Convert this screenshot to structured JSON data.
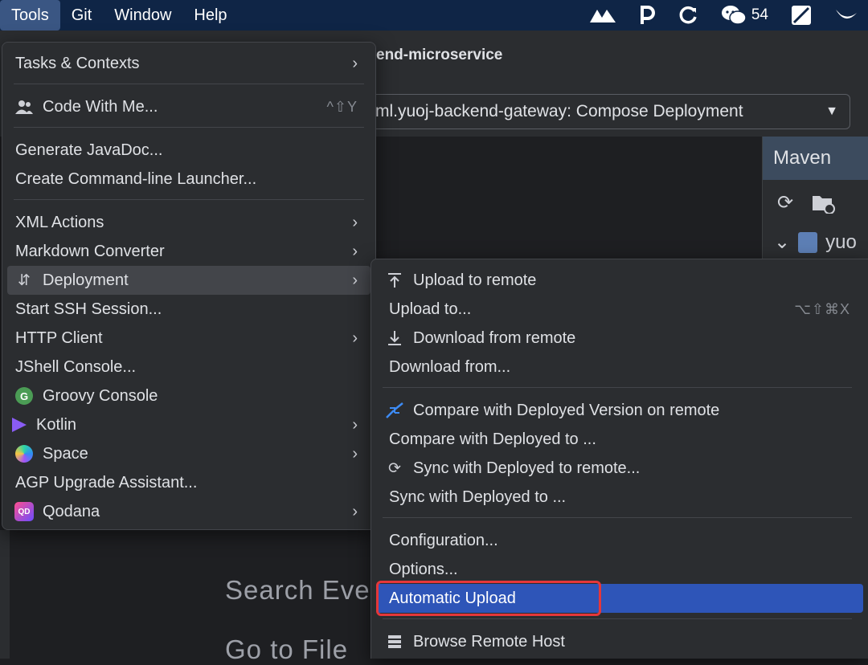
{
  "menubar": {
    "items": [
      {
        "label": "Tools",
        "active": true
      },
      {
        "label": "Git",
        "active": false
      },
      {
        "label": "Window",
        "active": false
      },
      {
        "label": "Help",
        "active": false
      }
    ],
    "tray": {
      "wechat_count": "54",
      "icons": [
        "mountain-icon",
        "p-icon",
        "refresh-circle-icon",
        "wechat-icon",
        "screen-icon",
        "bird-icon"
      ]
    }
  },
  "ide": {
    "project_title": "end-microservice",
    "run_config": "ml.yuoj-backend-gateway: Compose Deployment",
    "maven_title": "Maven",
    "maven_tree_item": "yuo",
    "editor_hint_1": "Search Ever",
    "editor_hint_2": "Go to File"
  },
  "tools_menu": {
    "items": [
      {
        "label": "Tasks & Contexts",
        "submenu": true
      },
      {
        "label": "Code With Me...",
        "shortcut": "^⇧Y",
        "icon": "users-icon"
      },
      {
        "label": "Generate JavaDoc..."
      },
      {
        "label": "Create Command-line Launcher..."
      },
      {
        "label": "XML Actions",
        "submenu": true
      },
      {
        "label": "Markdown Converter",
        "submenu": true
      },
      {
        "label": "Deployment",
        "submenu": true,
        "icon": "deployment-icon",
        "hovered": true
      },
      {
        "label": "Start SSH Session..."
      },
      {
        "label": "HTTP Client",
        "submenu": true
      },
      {
        "label": "JShell Console..."
      },
      {
        "label": "Groovy Console",
        "icon": "groovy-icon"
      },
      {
        "label": "Kotlin",
        "submenu": true,
        "icon": "kotlin-icon"
      },
      {
        "label": "Space",
        "submenu": true,
        "icon": "space-icon"
      },
      {
        "label": "AGP Upgrade Assistant..."
      },
      {
        "label": "Qodana",
        "submenu": true,
        "icon": "qodana-icon"
      }
    ]
  },
  "deployment_menu": {
    "items": [
      {
        "label": "Upload to remote",
        "icon": "upload-icon"
      },
      {
        "label": "Upload to...",
        "shortcut": "⌥⇧⌘X"
      },
      {
        "label": "Download from remote",
        "icon": "download-icon"
      },
      {
        "label": "Download from..."
      },
      {
        "label": "Compare with Deployed Version on remote",
        "icon": "compare-icon"
      },
      {
        "label": "Compare with Deployed to ..."
      },
      {
        "label": "Sync with Deployed to remote...",
        "icon": "sync-icon"
      },
      {
        "label": "Sync with Deployed to ..."
      },
      {
        "label": "Configuration..."
      },
      {
        "label": "Options..."
      },
      {
        "label": "Automatic Upload",
        "selected": true
      },
      {
        "label": "Browse Remote Host",
        "icon": "server-icon"
      }
    ]
  },
  "colors": {
    "menubar_bg": "#0f2546",
    "menu_bg": "#2b2d30",
    "selection": "#2e55b8",
    "highlight_border": "#e5373a"
  }
}
